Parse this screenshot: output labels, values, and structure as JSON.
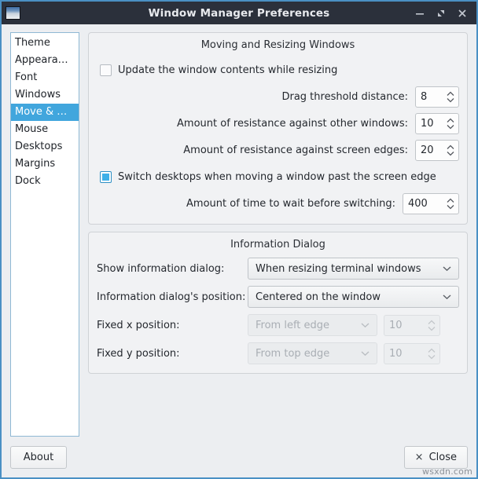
{
  "window": {
    "title": "Window Manager Preferences",
    "icon": "window-icon",
    "buttons": {
      "minimize": "minimize-icon",
      "maximize": "maximize-icon",
      "close": "close-icon"
    }
  },
  "sidebar": {
    "items": [
      {
        "label": "Theme",
        "selected": false
      },
      {
        "label": "Appeara…",
        "selected": false
      },
      {
        "label": "Font",
        "selected": false
      },
      {
        "label": "Windows",
        "selected": false
      },
      {
        "label": "Move & …",
        "selected": true
      },
      {
        "label": "Mouse",
        "selected": false
      },
      {
        "label": "Desktops",
        "selected": false
      },
      {
        "label": "Margins",
        "selected": false
      },
      {
        "label": "Dock",
        "selected": false
      }
    ]
  },
  "moving_group": {
    "title": "Moving and Resizing Windows",
    "update_contents": {
      "label": "Update the window contents while resizing",
      "checked": false
    },
    "drag_threshold": {
      "label": "Drag threshold distance:",
      "value": "8"
    },
    "resistance_windows": {
      "label": "Amount of resistance against other windows:",
      "value": "10"
    },
    "resistance_edges": {
      "label": "Amount of resistance against screen edges:",
      "value": "20"
    },
    "switch_desktops": {
      "label": "Switch desktops when moving a window past the screen edge",
      "checked": true
    },
    "wait_time": {
      "label": "Amount of time to wait before switching:",
      "value": "400"
    }
  },
  "info_group": {
    "title": "Information Dialog",
    "show_dialog": {
      "label": "Show information dialog:",
      "value": "When resizing terminal windows"
    },
    "dialog_position": {
      "label": "Information dialog's position:",
      "value": "Centered on the window"
    },
    "fixed_x": {
      "label": "Fixed x position:",
      "value": "From left edge",
      "number": "10",
      "enabled": false
    },
    "fixed_y": {
      "label": "Fixed y position:",
      "value": "From top edge",
      "number": "10",
      "enabled": false
    }
  },
  "footer": {
    "about_label": "About",
    "close_label": "Close",
    "close_icon": "×",
    "watermark": "wsxdn.com"
  },
  "colors": {
    "titlebar": "#2b303b",
    "window_border": "#4a90c4",
    "selection": "#41a6dd",
    "checkbox_fill": "#3fb0e8",
    "content_bg": "#eceef1"
  }
}
